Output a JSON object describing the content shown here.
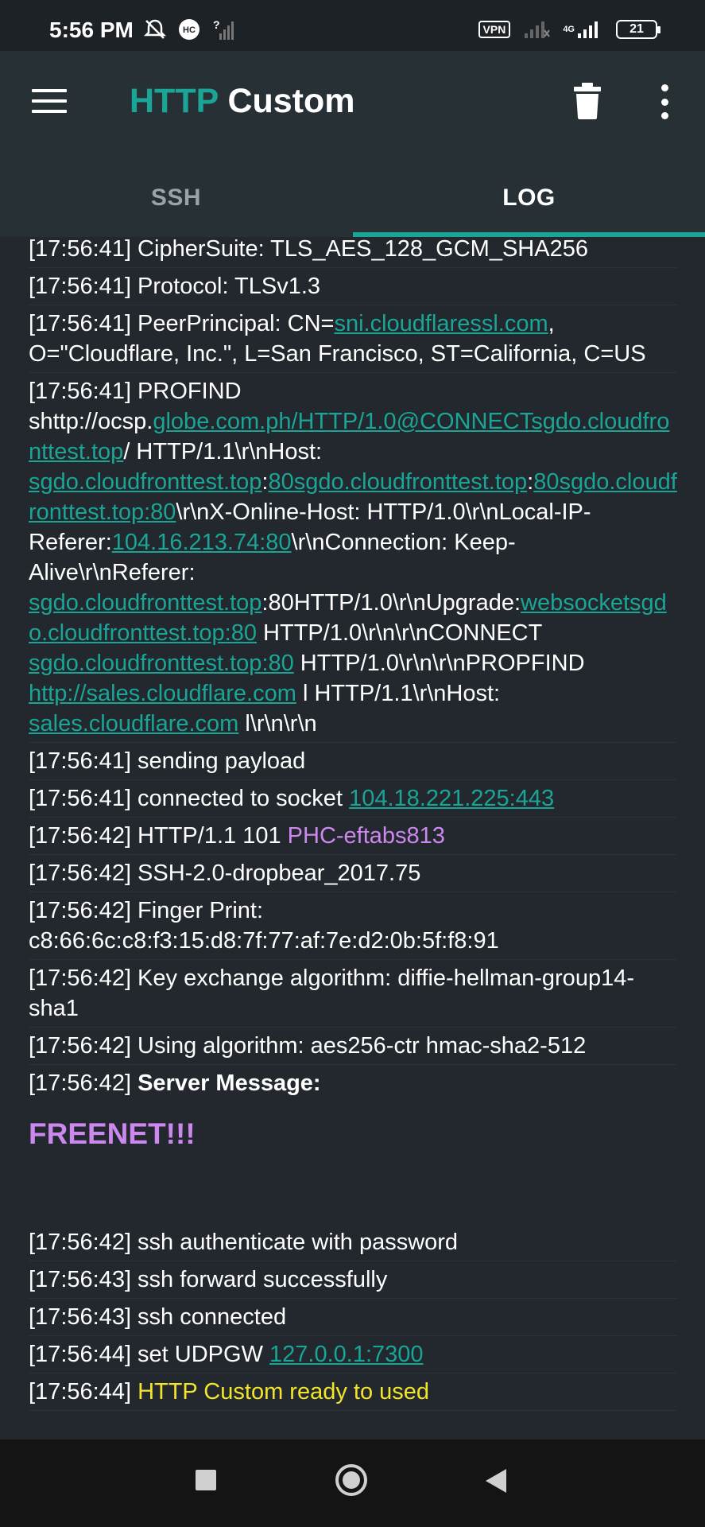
{
  "status_bar": {
    "time": "5:56 PM",
    "vpn": "VPN",
    "network": "4G",
    "battery": "21"
  },
  "app_bar": {
    "title_accent": "HTTP",
    "title_main": "Custom"
  },
  "tabs": [
    {
      "label": "SSH",
      "active": false
    },
    {
      "label": "LOG",
      "active": true
    }
  ],
  "log": {
    "e0": {
      "text": "[17:56:41] CipherSuite: TLS_AES_128_GCM_SHA256"
    },
    "e1": {
      "text": "[17:56:41] Protocol: TLSv1.3"
    },
    "e2": {
      "t1": "[17:56:41] PeerPrincipal: CN=",
      "l1": "sni.cloudflaressl.com",
      "t2": ", O=\"Cloudflare, Inc.\", L=San Francisco, ST=California, C=US"
    },
    "e3": {
      "t1": "[17:56:41] PROFIND shttp://ocsp.",
      "l1": "globe.com.ph/HTTP/1.0@CONNECTsgdo.cloudfronttest.top",
      "t2": "/ HTTP/1.1\\r\\nHost: ",
      "l2": "sgdo.cloudfronttest.top",
      "t3": ":",
      "l3": "80sgdo.cloudfronttest.top",
      "t4": ":",
      "l4": "80sgdo.cloudfronttest.top:80",
      "t5": "\\r\\nX-Online-Host: HTTP/1.0\\r\\nLocal-IP-Referer:",
      "l5": "104.16.213.74:80",
      "t6": "\\r\\nConnection: Keep-Alive\\r\\nReferer: ",
      "l6": "sgdo.cloudfronttest.top",
      "t7": ":80HTTP/1.0\\r\\nUpgrade:",
      "l7": "websocketsgdo.cloudfronttest.top:80",
      "t8": " HTTP/1.0\\r\\n\\r\\nCONNECT ",
      "l8": "sgdo.cloudfronttest.top:80",
      "t9": " HTTP/1.0\\r\\n\\r\\nPROPFIND ",
      "l9": "http://sales.cloudflare.com",
      "t10": " l HTTP/1.1\\r\\nHost: ",
      "l10": "sales.cloudflare.com",
      "t11": " l\\r\\n\\r\\n"
    },
    "e4": {
      "text": "[17:56:41] sending payload"
    },
    "e5": {
      "t1": "[17:56:41] connected to socket ",
      "l1": "104.18.221.225:443"
    },
    "e6": {
      "t1": "[17:56:42] HTTP/1.1 101 ",
      "p1": "PHC-eftabs813"
    },
    "e7": {
      "text": "[17:56:42] SSH-2.0-dropbear_2017.75"
    },
    "e8": {
      "text": "[17:56:42] Finger Print: c8:66:6c:c8:f3:15:d8:7f:77:af:7e:d2:0b:5f:f8:91"
    },
    "e9": {
      "text": "[17:56:42] Key exchange algorithm: diffie-hellman-group14-sha1"
    },
    "e10": {
      "text": "[17:56:42] Using algorithm: aes256-ctr hmac-sha2-512"
    },
    "e11": {
      "t1": "[17:56:42] ",
      "b1": "Server Message:",
      "message": "FREENET!!!"
    },
    "e12": {
      "text": "[17:56:42] ssh authenticate with password"
    },
    "e13": {
      "text": "[17:56:43] ssh forward successfully"
    },
    "e14": {
      "text": "[17:56:43] ssh connected"
    },
    "e15": {
      "t1": "[17:56:44] set UDPGW ",
      "l1": "127.0.0.1:7300"
    },
    "e16": {
      "t1": "[17:56:44] ",
      "y1": "HTTP Custom ready to used"
    }
  }
}
